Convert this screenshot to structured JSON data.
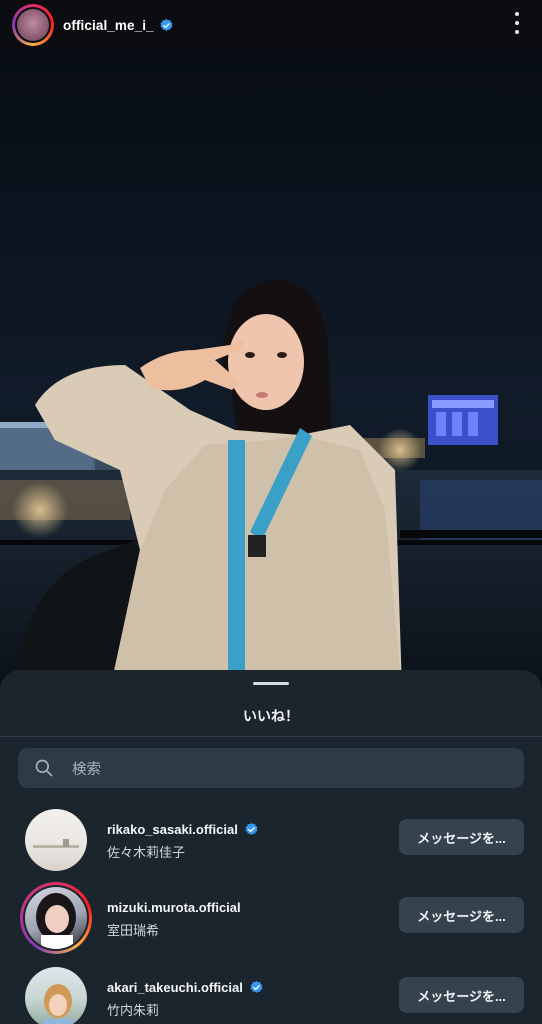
{
  "header": {
    "username": "official_me_i_",
    "verified": true
  },
  "sheet": {
    "title": "いいね！",
    "search": {
      "placeholder": "検索"
    }
  },
  "likers": [
    {
      "handle": "rikako_sasaki.official",
      "name": "佐々木莉佳子",
      "verified": true,
      "has_story_ring": false,
      "button_label": "メッセージを..."
    },
    {
      "handle": "mizuki.murota.official",
      "name": "室田瑞希",
      "verified": false,
      "has_story_ring": true,
      "button_label": "メッセージを..."
    },
    {
      "handle": "akari_takeuchi.official",
      "name": "竹内朱莉",
      "verified": true,
      "has_story_ring": false,
      "button_label": "メッセージを..."
    }
  ],
  "colors": {
    "verified_blue": "#3897f0",
    "sheet_bg": "#1b252e",
    "button_bg": "#36434f"
  }
}
